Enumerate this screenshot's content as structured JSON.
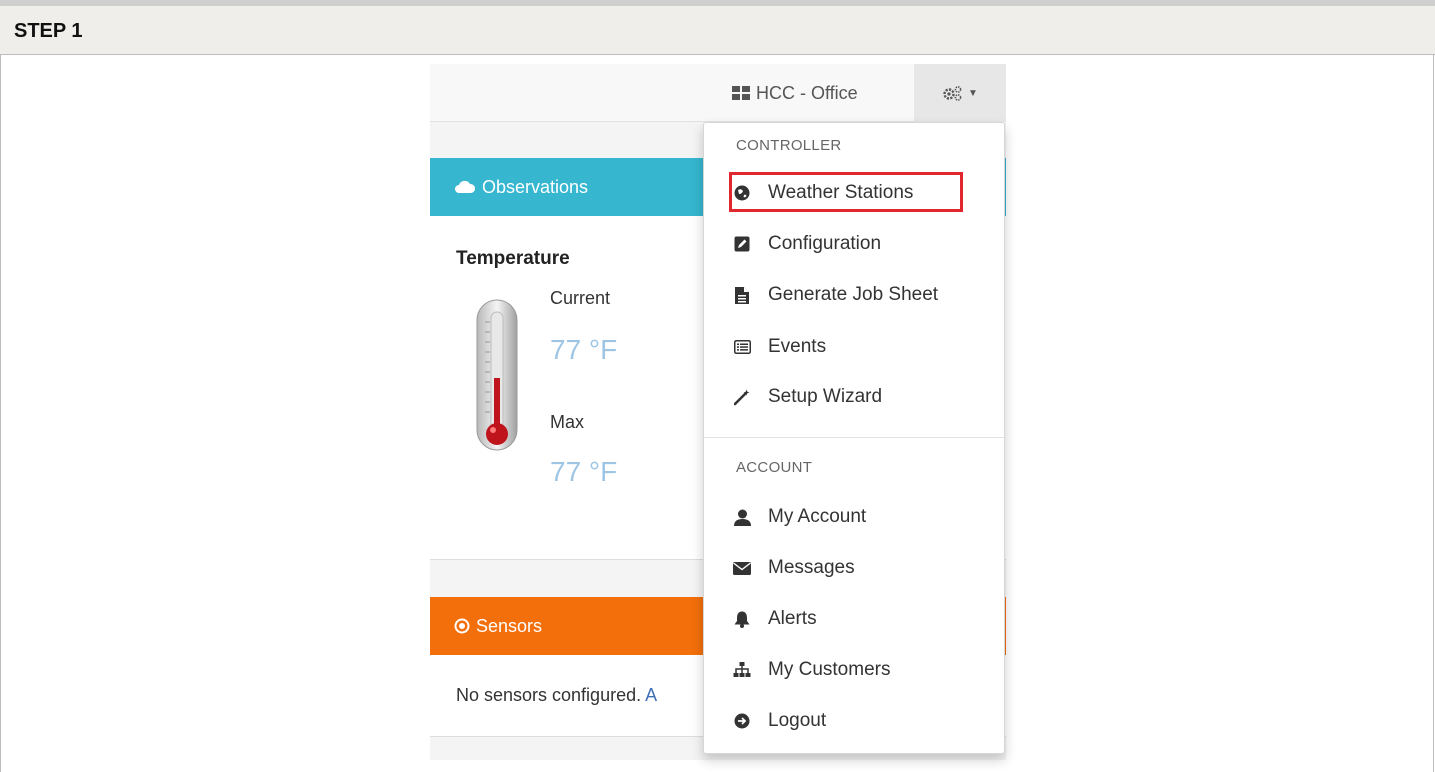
{
  "step": {
    "title": "STEP 1"
  },
  "navbar": {
    "site_label": "HCC - Office",
    "grid_icon": "th-large-icon",
    "settings_icon": "cogs-icon"
  },
  "observations": {
    "title": "Observations",
    "icon": "cloud-icon",
    "section_label": "Temperature",
    "current_label": "Current",
    "current_value": "77 °F",
    "max_label": "Max",
    "max_value": "77 °F",
    "thermometer_level": 0.45
  },
  "sensors": {
    "title": "Sensors",
    "icon": "dot-circle-icon",
    "empty_text": "No sensors configured.",
    "link_text": "A"
  },
  "dropdown": {
    "controller_header": "CONTROLLER",
    "controller_items": [
      {
        "label": "Weather Stations",
        "icon": "globe-icon"
      },
      {
        "label": "Configuration",
        "icon": "edit-icon"
      },
      {
        "label": "Generate Job Sheet",
        "icon": "file-text-icon"
      },
      {
        "label": "Events",
        "icon": "list-alt-icon"
      },
      {
        "label": "Setup Wizard",
        "icon": "magic-wand-icon"
      }
    ],
    "account_header": "ACCOUNT",
    "account_items": [
      {
        "label": "My Account",
        "icon": "user-icon"
      },
      {
        "label": "Messages",
        "icon": "envelope-icon"
      },
      {
        "label": "Alerts",
        "icon": "bell-icon"
      },
      {
        "label": "My Customers",
        "icon": "sitemap-icon"
      },
      {
        "label": "Logout",
        "icon": "sign-out-icon"
      }
    ]
  },
  "colors": {
    "observations_header": "#36b6cf",
    "sensors_header": "#f26f0b",
    "temperature_value": "#9ec6e4",
    "highlight_border": "#e0262e"
  }
}
